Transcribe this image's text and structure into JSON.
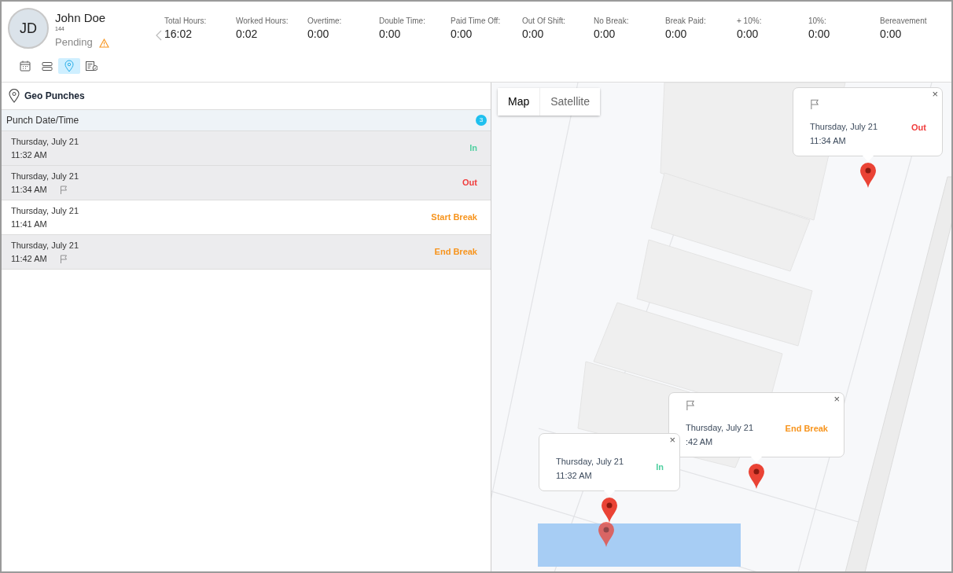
{
  "employee": {
    "initials": "JD",
    "name": "John Doe",
    "id": "144",
    "status": "Pending",
    "warning": true
  },
  "view_tabs": [
    {
      "selected": false
    },
    {
      "selected": false
    },
    {
      "selected": true
    },
    {
      "selected": false
    }
  ],
  "stats": [
    {
      "label": "Total Hours:",
      "value": "16:02"
    },
    {
      "label": "Worked Hours:",
      "value": "0:02"
    },
    {
      "label": "Overtime:",
      "value": "0:00"
    },
    {
      "label": "Double Time:",
      "value": "0:00"
    },
    {
      "label": "Paid Time Off:",
      "value": "0:00"
    },
    {
      "label": "Out Of Shift:",
      "value": "0:00"
    },
    {
      "label": "No Break:",
      "value": "0:00"
    },
    {
      "label": "Break Paid:",
      "value": "0:00"
    },
    {
      "label": "+ 10%:",
      "value": "0:00"
    },
    {
      "label": "10%:",
      "value": "0:00"
    },
    {
      "label": "Bereavement",
      "value": "0:00"
    }
  ],
  "panel": {
    "title": "Geo Punches",
    "column": "Punch Date/Time",
    "count": "3"
  },
  "punches": [
    {
      "date": "Thursday, July 21",
      "time": "11:32 AM",
      "type": "In",
      "kind": "in",
      "flagged": false,
      "selected": true
    },
    {
      "date": "Thursday, July 21",
      "time": "11:34 AM",
      "type": "Out",
      "kind": "out",
      "flagged": true,
      "selected": true
    },
    {
      "date": "Thursday, July 21",
      "time": "11:41 AM",
      "type": "Start Break",
      "kind": "break",
      "flagged": false,
      "selected": false
    },
    {
      "date": "Thursday, July 21",
      "time": "11:42 AM",
      "type": "End Break",
      "kind": "break",
      "flagged": true,
      "selected": true
    }
  ],
  "map": {
    "map_types": [
      {
        "label": "Map",
        "selected": true
      },
      {
        "label": "Satellite",
        "selected": false
      }
    ],
    "popups": [
      {
        "date": "Thursday, July 21",
        "time": "11:34 AM",
        "type": "Out",
        "kind": "out",
        "flagged": true,
        "close": "×"
      },
      {
        "date": "Thursday, July 21",
        "time": ":42 AM",
        "type": "End Break",
        "kind": "break",
        "flagged": true,
        "close": "×"
      },
      {
        "date": "Thursday, July 21",
        "time": "11:32 AM",
        "type": "In",
        "kind": "in",
        "flagged": false,
        "close": "×"
      }
    ]
  }
}
